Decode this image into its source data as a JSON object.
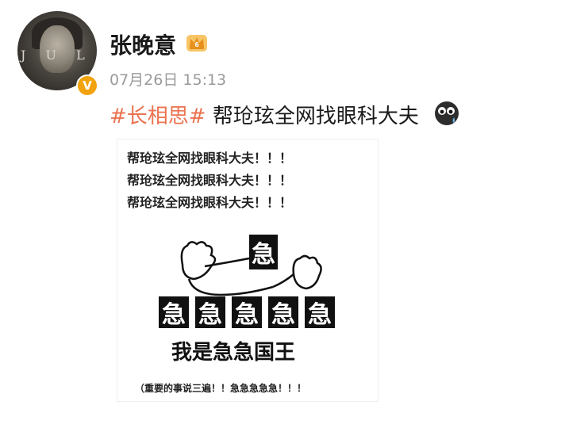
{
  "post": {
    "username": "张晚意",
    "avatar_text": "J U L E",
    "verified_badge": "V",
    "timestamp": "07月26日 15:13",
    "hashtag": "#长相思#",
    "body": " 帮玱玹全网找眼科大夫"
  },
  "icons": {
    "crown": "crown-icon",
    "sweat": "sweat-emoji-icon",
    "verified": "verified-icon"
  },
  "image": {
    "repeat_lines": [
      "帮玱玹全网找眼科大夫！！！",
      "帮玱玹全网找眼科大夫！！！",
      "帮玱玹全网找眼科大夫！！！"
    ],
    "top_char": "急",
    "row_chars": [
      "急",
      "急",
      "急",
      "急",
      "急"
    ],
    "king": "我是急急国王",
    "footer": "（重要的事说三遍！！急急急急急！！！"
  },
  "colors": {
    "hashtag": "#eb7350",
    "badge": "#f2a20c",
    "time": "#9a9a9a"
  }
}
